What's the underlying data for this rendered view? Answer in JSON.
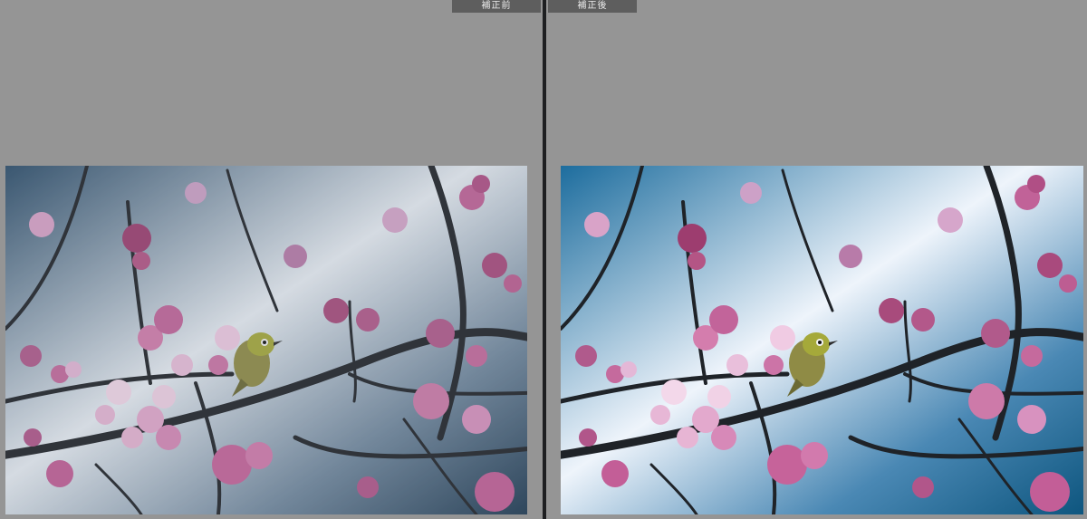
{
  "compare_view": {
    "before": {
      "label": "補正前",
      "image": "cherry-blossom-bird-photo"
    },
    "after": {
      "label": "補正後",
      "image": "cherry-blossom-bird-photo"
    }
  },
  "colors": {
    "panel_bg": "#959595",
    "divider": "#1e1f21",
    "label_bg": "#5e5e5e",
    "label_text": "#eaeaea"
  }
}
